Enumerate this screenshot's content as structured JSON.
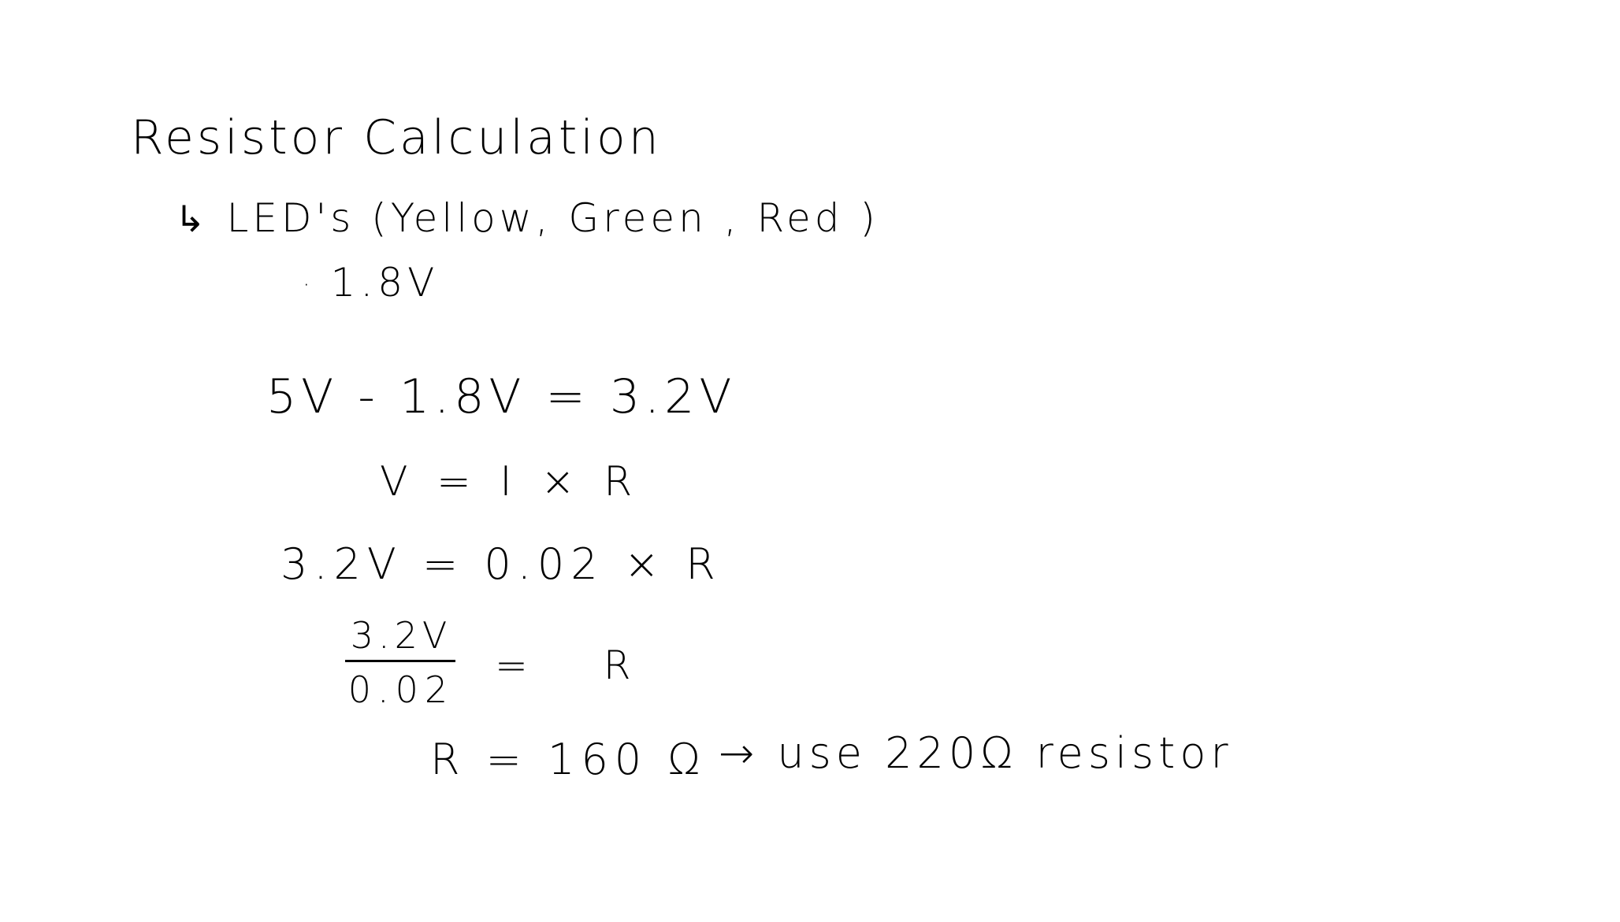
{
  "title": "Resistor Calculation",
  "subhead": {
    "arrow": "↳",
    "text": "LED's (Yellow, Green , Red )"
  },
  "bullet": {
    "dot": "·",
    "text": "1.8V"
  },
  "equations": {
    "line1": "5V - 1.8V = 3.2V",
    "line2": "V = I × R",
    "line3": "3.2V = 0.02 × R",
    "fraction": {
      "numerator": "3.2V",
      "denominator": "0.02",
      "rhs": "= R"
    },
    "result": "R = 160 Ω"
  },
  "note": "→ use 220Ω resistor"
}
